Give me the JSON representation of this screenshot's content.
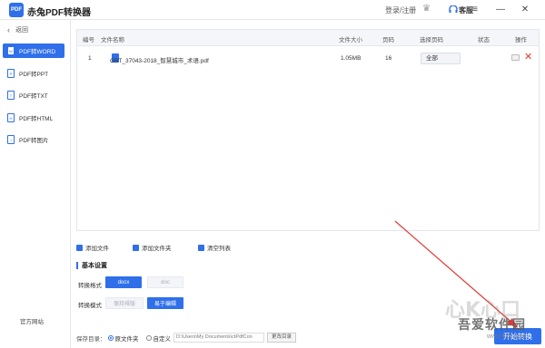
{
  "app": {
    "logo_text": "PDF",
    "title": "赤兔PDF转换器",
    "login_label": "登录/注册",
    "service_label": "客服"
  },
  "colors": {
    "accent": "#2f6fea",
    "delete": "#e53935"
  },
  "sidebar": {
    "back_label": "返回",
    "items": [
      {
        "label": "PDF转WORD",
        "icon": "W"
      },
      {
        "label": "PDF转PPT",
        "icon": "P"
      },
      {
        "label": "PDF转TXT",
        "icon": "T"
      },
      {
        "label": "PDF转HTML",
        "icon": "H"
      },
      {
        "label": "PDF转图片",
        "icon": "I"
      }
    ],
    "active_index": 0,
    "official_site": "官方网站"
  },
  "table": {
    "headers": {
      "index": "编号",
      "name": "文件名称",
      "size": "文件大小",
      "pages": "页码",
      "range": "选择页码",
      "status": "状态",
      "action": "操作"
    },
    "rows": [
      {
        "index": "1",
        "name": "GBT_37043-2018_智慧城市_术语.pdf",
        "size": "1.05MB",
        "pages": "16",
        "range": "全部",
        "status": ""
      }
    ]
  },
  "actions": {
    "add_file": "添加文件",
    "add_folder": "添加文件夹",
    "clear_list": "清空列表"
  },
  "settings": {
    "title": "基本设置",
    "format_label": "转换格式",
    "format_options": [
      "docx",
      "doc"
    ],
    "format_selected": "docx",
    "mode_label": "转换模式",
    "mode_options": [
      "保持排版",
      "易于编辑"
    ],
    "mode_selected": "易于编辑"
  },
  "save": {
    "label": "保存目录：",
    "option_original": "原文件夹",
    "option_custom": "自定义",
    "selected": "原文件夹",
    "path": "D:\\Users\\My Documents\\ctPdfCon",
    "change_dir": "更改目录"
  },
  "start_button": "开始转换",
  "watermark": {
    "text": "吾爱软件园",
    "url": "www.52z.com"
  }
}
